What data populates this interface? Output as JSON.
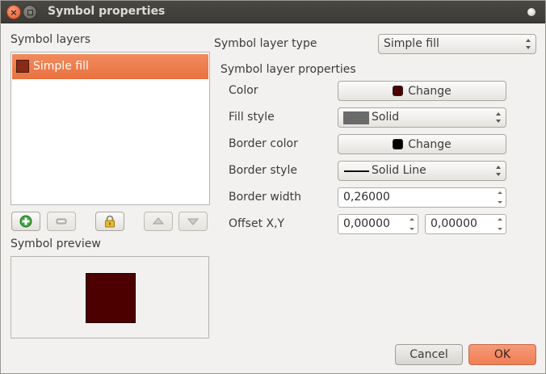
{
  "window": {
    "title": "Symbol properties"
  },
  "left": {
    "layers_label": "Symbol layers",
    "layers": [
      {
        "label": "Simple fill",
        "color": "#8a2a17",
        "selected": true
      }
    ],
    "toolbar": {
      "add_icon": "add-layer-icon",
      "remove_icon": "remove-layer-icon",
      "lock_icon": "lock-icon",
      "up_icon": "move-up-icon",
      "down_icon": "move-down-icon"
    },
    "preview_label": "Symbol preview",
    "preview_color": "#4d0000"
  },
  "right": {
    "layer_type_label": "Symbol layer type",
    "layer_type_value": "Simple fill",
    "properties_label": "Symbol layer properties",
    "color_label": "Color",
    "color_button": "Change",
    "color_value": "#4d0000",
    "fill_style_label": "Fill style",
    "fill_style_value": "Solid",
    "border_color_label": "Border color",
    "border_color_button": "Change",
    "border_color_value": "#000000",
    "border_style_label": "Border style",
    "border_style_value": "Solid Line",
    "border_width_label": "Border width",
    "border_width_value": "0,26000",
    "offset_label": "Offset X,Y",
    "offset_x": "0,00000",
    "offset_y": "0,00000"
  },
  "buttons": {
    "cancel": "Cancel",
    "ok": "OK"
  }
}
